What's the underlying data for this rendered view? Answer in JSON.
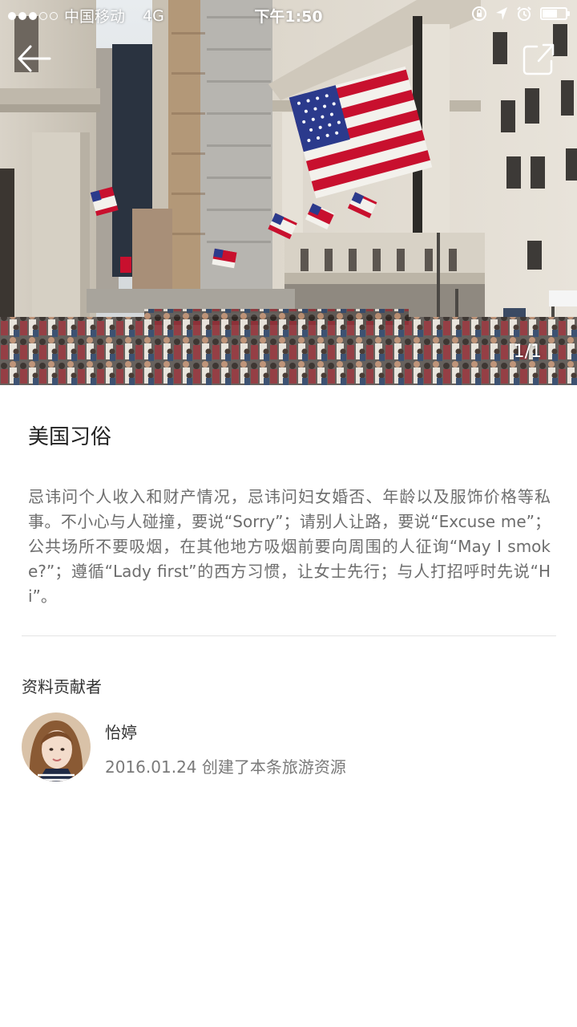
{
  "status_bar": {
    "carrier": "中国移动",
    "network": "4G",
    "time": "下午1:50",
    "signal_bars_filled": 3,
    "signal_bars_total": 5
  },
  "hero": {
    "page_counter": "1/1",
    "icons": {
      "back": "back-arrow-icon",
      "share": "share-icon"
    }
  },
  "article": {
    "title": "美国习俗",
    "body": "忌讳问个人收入和财产情况，忌讳问妇女婚否、年龄以及服饰价格等私事。不小心与人碰撞，要说“Sorry”；请别人让路，要说“Excuse me”；公共场所不要吸烟，在其他地方吸烟前要向周围的人征询“May I smoke?”；遵循“Lady first”的西方习惯，让女士先行；与人打招呼时先说“Hi”。"
  },
  "contributor": {
    "heading": "资料贡献者",
    "name": "怡婷",
    "info": "2016.01.24 创建了本条旅游资源"
  },
  "colors": {
    "title_text": "#222222",
    "body_text": "#6d6d6d",
    "divider": "#e4e4e4",
    "flag_red": "#c8102e",
    "flag_blue": "#2b3a8c"
  }
}
